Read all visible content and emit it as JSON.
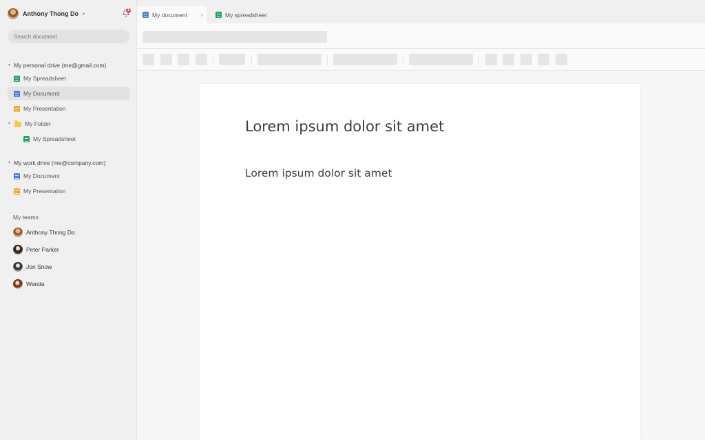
{
  "user": {
    "name": "Anthony Thong Do",
    "caret": "▾"
  },
  "notifications": {
    "count": "1"
  },
  "search": {
    "placeholder": "Search document"
  },
  "drives": [
    {
      "title": "My personal drive (me@gmail.com)",
      "items": [
        {
          "label": "My Spreadsheet",
          "type": "sheet"
        },
        {
          "label": "My Document",
          "type": "doc"
        },
        {
          "label": "My Presentation",
          "type": "pres"
        },
        {
          "label": "My Folder",
          "type": "folder"
        },
        {
          "label": "My Spreadsheet",
          "type": "sheet"
        }
      ]
    },
    {
      "title": "My work drive (me@company.com)",
      "items": [
        {
          "label": "My Document",
          "type": "doc"
        },
        {
          "label": "My Presentation",
          "type": "pres"
        }
      ]
    }
  ],
  "teams": {
    "title": "My teams",
    "members": [
      "Anthony Thong Do",
      "Peter Parker",
      "Jon Snow",
      "Wanda"
    ]
  },
  "tabs": [
    {
      "label": "My document",
      "close": "×"
    },
    {
      "label": "My spreadsheet"
    }
  ],
  "document": {
    "heading1": "Lorem ipsum dolor sit amet",
    "heading2": "Lorem ipsum dolor sit amet"
  },
  "colors": {
    "sheet": "#1fa463",
    "doc": "#4a7fe0",
    "presentation": "#f5a623",
    "folder": "#f8c844",
    "badge": "#e24a4a"
  }
}
